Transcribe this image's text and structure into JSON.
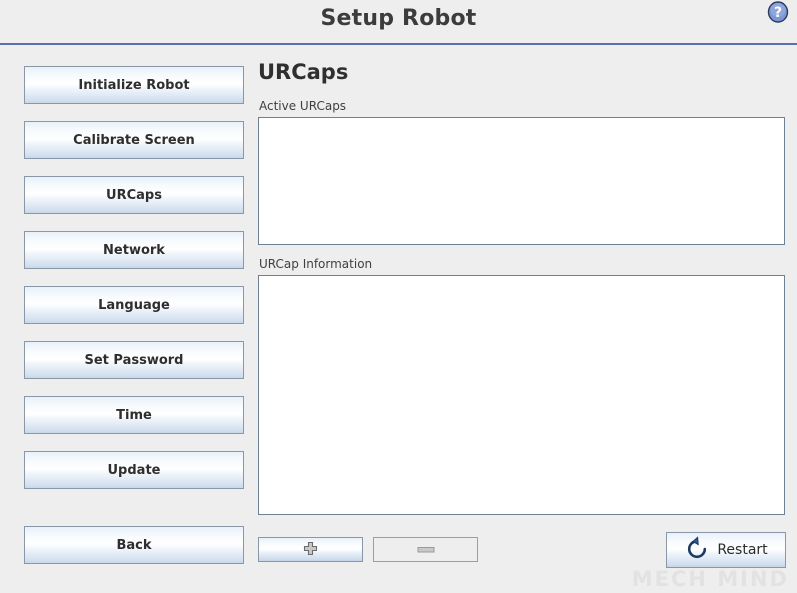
{
  "window": {
    "title": "Setup Robot",
    "help_icon": "question-mark-circle-icon",
    "watermark": "MECH MIND",
    "accent_color": "#5a6fb0",
    "background_color": "#eeeeee",
    "panel_border_color": "#6e8193",
    "button_border_color": "#8a97a6"
  },
  "sidebar": {
    "items": [
      {
        "label": "Initialize Robot"
      },
      {
        "label": "Calibrate Screen"
      },
      {
        "label": "URCaps"
      },
      {
        "label": "Network"
      },
      {
        "label": "Language"
      },
      {
        "label": "Set Password"
      },
      {
        "label": "Time"
      },
      {
        "label": "Update"
      }
    ],
    "back": {
      "label": "Back"
    }
  },
  "main": {
    "section_title": "URCaps",
    "active_urcaps": {
      "label": "Active URCaps",
      "items": [],
      "content": ""
    },
    "urcap_information": {
      "label": "URCap Information",
      "content": ""
    },
    "toolbar": {
      "add": {
        "icon": "plus-icon",
        "label": "",
        "enabled": true
      },
      "remove": {
        "icon": "minus-icon",
        "label": "",
        "enabled": false
      },
      "restart": {
        "icon": "restart-circular-arrow-icon",
        "label": "Restart",
        "enabled": true
      }
    }
  }
}
